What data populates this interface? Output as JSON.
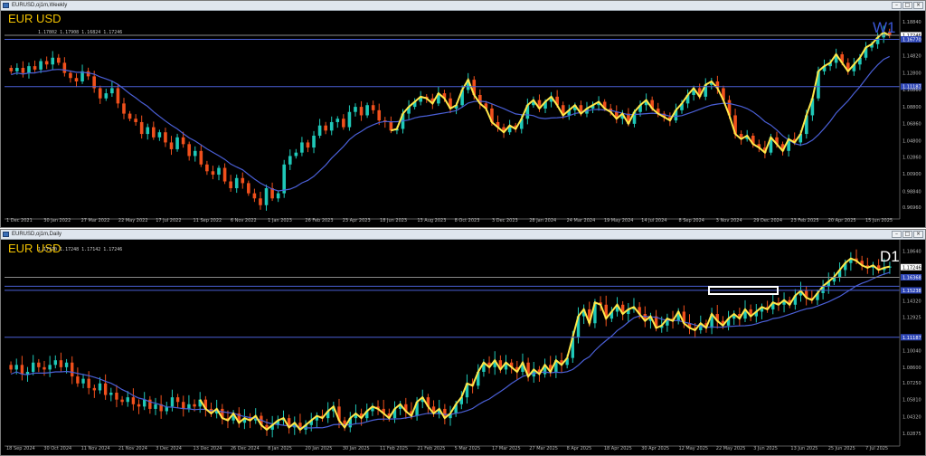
{
  "windows": [
    {
      "id": "w1",
      "title": "EURUSD,oj1m,Weekly",
      "symbol": "EUR USD",
      "timeframe": "W1",
      "ohlc": "1.17802 1.17908 1.16824 1.17246",
      "price_labels": [
        "1.18840",
        "1.17246",
        "1.16770",
        "1.14820",
        "1.12800",
        "1.11187",
        "1.10860",
        "1.08800",
        "1.06860",
        "1.04800",
        "1.02860",
        "1.00900",
        "0.98840",
        "0.96960"
      ],
      "highlight_labels": [
        "1.17246",
        "1.16770",
        "1.11187"
      ],
      "date_labels": [
        "1 Dec 2021",
        "30 Jan 2022",
        "27 Mar 2022",
        "22 May 2022",
        "17 Jul 2022",
        "11 Sep 2022",
        "6 Nov 2022",
        "1 Jan 2023",
        "26 Feb 2023",
        "23 Apr 2023",
        "18 Jun 2023",
        "13 Aug 2023",
        "8 Oct 2023",
        "3 Dec 2023",
        "28 Jan 2024",
        "24 Mar 2024",
        "19 May 2024",
        "14 Jul 2024",
        "8 Sep 2024",
        "3 Nov 2024",
        "29 Dec 2024",
        "23 Feb 2025",
        "20 Apr 2025",
        "15 Jun 2025"
      ],
      "price_range": [
        0.96,
        1.197
      ],
      "hlines": [
        1.1724,
        1.1677,
        1.1118
      ],
      "closes": [
        1.13,
        1.134,
        1.128,
        1.136,
        1.132,
        1.142,
        1.138,
        1.146,
        1.14,
        1.128,
        1.122,
        1.118,
        1.13,
        1.124,
        1.11,
        1.098,
        1.104,
        1.11,
        1.092,
        1.08,
        1.074,
        1.07,
        1.056,
        1.064,
        1.052,
        1.058,
        1.046,
        1.038,
        1.052,
        1.044,
        1.03,
        1.036,
        1.02,
        1.012,
        1.008,
        1.016,
        1.0,
        0.992,
        1.004,
        0.998,
        0.986,
        0.98,
        0.972,
        0.992,
        0.98,
        0.986,
        1.02,
        1.03,
        1.034,
        1.046,
        1.04,
        1.054,
        1.066,
        1.06,
        1.07,
        1.074,
        1.064,
        1.082,
        1.088,
        1.078,
        1.09,
        1.084,
        1.072,
        1.07,
        1.06,
        1.062,
        1.08,
        1.088,
        1.094,
        1.1,
        1.098,
        1.092,
        1.104,
        1.098,
        1.086,
        1.09,
        1.108,
        1.12,
        1.102,
        1.092,
        1.086,
        1.07,
        1.064,
        1.058,
        1.066,
        1.062,
        1.074,
        1.09,
        1.096,
        1.086,
        1.094,
        1.1,
        1.09,
        1.078,
        1.084,
        1.09,
        1.08,
        1.086,
        1.09,
        1.094,
        1.086,
        1.082,
        1.074,
        1.08,
        1.068,
        1.082,
        1.09,
        1.096,
        1.086,
        1.08,
        1.076,
        1.072,
        1.084,
        1.092,
        1.102,
        1.11,
        1.1,
        1.114,
        1.118,
        1.11,
        1.096,
        1.078,
        1.056,
        1.05,
        1.054,
        1.044,
        1.04,
        1.034,
        1.052,
        1.044,
        1.036,
        1.05,
        1.046,
        1.056,
        1.078,
        1.098,
        1.13,
        1.136,
        1.14,
        1.15,
        1.14,
        1.13,
        1.138,
        1.146,
        1.158,
        1.162,
        1.17,
        1.176,
        1.172
      ]
    },
    {
      "id": "d1",
      "title": "EURUSD,oj1m,Daily",
      "symbol": "EUR USD",
      "timeframe": "D1",
      "ohlc": "1.17170 1.17248 1.17142 1.17246",
      "price_labels": [
        "1.18640",
        "1.17246",
        "1.16368",
        "1.15238",
        "1.14320",
        "1.12925",
        "1.11187",
        "1.10040",
        "1.08600",
        "1.07250",
        "1.05810",
        "1.04320",
        "1.02875"
      ],
      "highlight_labels": [
        "1.17246",
        "1.16368",
        "1.15238",
        "1.11187"
      ],
      "date_labels": [
        "18 Sep 2024",
        "30 Oct 2024",
        "11 Nov 2024",
        "21 Nov 2024",
        "3 Dec 2024",
        "13 Dec 2024",
        "26 Dec 2024",
        "8 Jan 2025",
        "20 Jan 2025",
        "30 Jan 2025",
        "11 Feb 2025",
        "21 Feb 2025",
        "5 Mar 2025",
        "17 Mar 2025",
        "27 Mar 2025",
        "8 Apr 2025",
        "18 Apr 2025",
        "30 Apr 2025",
        "12 May 2025",
        "22 May 2025",
        "3 Jun 2025",
        "13 Jun 2025",
        "25 Jun 2025",
        "7 Jul 2025"
      ],
      "price_range": [
        1.021,
        1.193
      ],
      "hlines": [
        1.1637,
        1.156,
        1.1524,
        1.1119
      ],
      "closes": [
        1.084,
        1.088,
        1.08,
        1.082,
        1.09,
        1.086,
        1.084,
        1.088,
        1.092,
        1.086,
        1.09,
        1.078,
        1.072,
        1.076,
        1.068,
        1.066,
        1.072,
        1.062,
        1.064,
        1.058,
        1.056,
        1.06,
        1.054,
        1.052,
        1.058,
        1.05,
        1.054,
        1.048,
        1.052,
        1.06,
        1.056,
        1.05,
        1.054,
        1.052,
        1.058,
        1.05,
        1.046,
        1.05,
        1.042,
        1.04,
        1.046,
        1.038,
        1.042,
        1.04,
        1.044,
        1.036,
        1.032,
        1.036,
        1.04,
        1.042,
        1.034,
        1.038,
        1.032,
        1.036,
        1.04,
        1.044,
        1.042,
        1.048,
        1.052,
        1.04,
        1.034,
        1.042,
        1.046,
        1.042,
        1.048,
        1.052,
        1.05,
        1.046,
        1.042,
        1.05,
        1.054,
        1.048,
        1.044,
        1.056,
        1.06,
        1.052,
        1.046,
        1.05,
        1.042,
        1.046,
        1.054,
        1.06,
        1.072,
        1.07,
        1.082,
        1.09,
        1.086,
        1.092,
        1.084,
        1.09,
        1.086,
        1.082,
        1.09,
        1.078,
        1.084,
        1.08,
        1.088,
        1.082,
        1.092,
        1.088,
        1.094,
        1.112,
        1.13,
        1.136,
        1.124,
        1.142,
        1.14,
        1.128,
        1.134,
        1.14,
        1.132,
        1.136,
        1.138,
        1.132,
        1.126,
        1.13,
        1.12,
        1.122,
        1.128,
        1.126,
        1.134,
        1.124,
        1.12,
        1.118,
        1.124,
        1.12,
        1.132,
        1.126,
        1.122,
        1.128,
        1.132,
        1.128,
        1.136,
        1.13,
        1.134,
        1.138,
        1.136,
        1.142,
        1.14,
        1.144,
        1.14,
        1.148,
        1.152,
        1.146,
        1.144,
        1.15,
        1.156,
        1.16,
        1.164,
        1.17,
        1.176,
        1.18,
        1.178,
        1.174,
        1.172,
        1.174,
        1.17,
        1.172,
        1.173
      ]
    }
  ],
  "colors": {
    "background": "#000000",
    "bull_candle": "#1fc8b8",
    "bear_candle": "#f0501c",
    "moving_average": "#4a5fd6",
    "zigzag": "#ffe84a",
    "hline": "#4a5fd6",
    "box": "#ffffff"
  },
  "icons": [
    "app-icon",
    "minimize-icon",
    "maximize-icon",
    "close-icon"
  ]
}
